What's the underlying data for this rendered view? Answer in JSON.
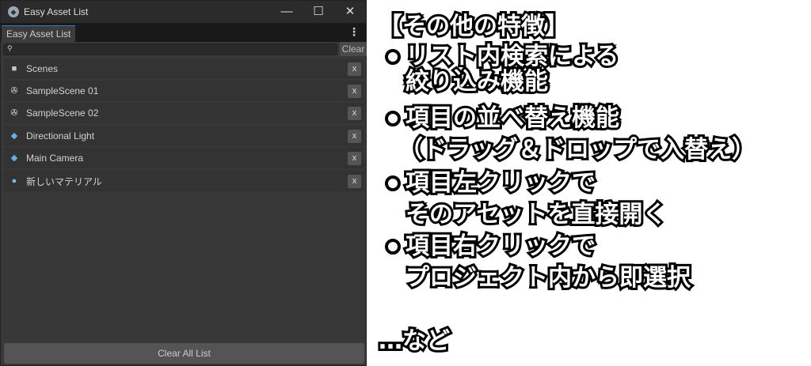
{
  "window": {
    "title": "Easy Asset List",
    "minimize": "—",
    "maximize": "☐",
    "close": "✕"
  },
  "tab": {
    "label": "Easy Asset List",
    "menu": "⋮"
  },
  "search": {
    "value": "",
    "clear_label": "Clear"
  },
  "items": [
    {
      "label": "Scenes",
      "icon": "folder-icon",
      "remove": "x"
    },
    {
      "label": "SampleScene 01",
      "icon": "unity-scene-icon",
      "remove": "x"
    },
    {
      "label": "SampleScene 02",
      "icon": "unity-scene-icon",
      "remove": "x"
    },
    {
      "label": "Directional Light",
      "icon": "prefab-cube-icon",
      "remove": "x"
    },
    {
      "label": "Main Camera",
      "icon": "prefab-cube-icon",
      "remove": "x"
    },
    {
      "label": "新しいマテリアル",
      "icon": "material-sphere-icon",
      "remove": "x"
    }
  ],
  "clear_all_label": "Clear All List",
  "features": {
    "title": "【その他の特徴】",
    "lines": [
      "リスト内検索による",
      "絞り込み機能",
      "項目の並べ替え機能",
      "（ドラッグ＆ドロップで入替え）",
      "項目左クリックで",
      "そのアセットを直接開く",
      "項目右クリックで",
      "プロジェクト内から即選択"
    ],
    "footer": "…など"
  }
}
